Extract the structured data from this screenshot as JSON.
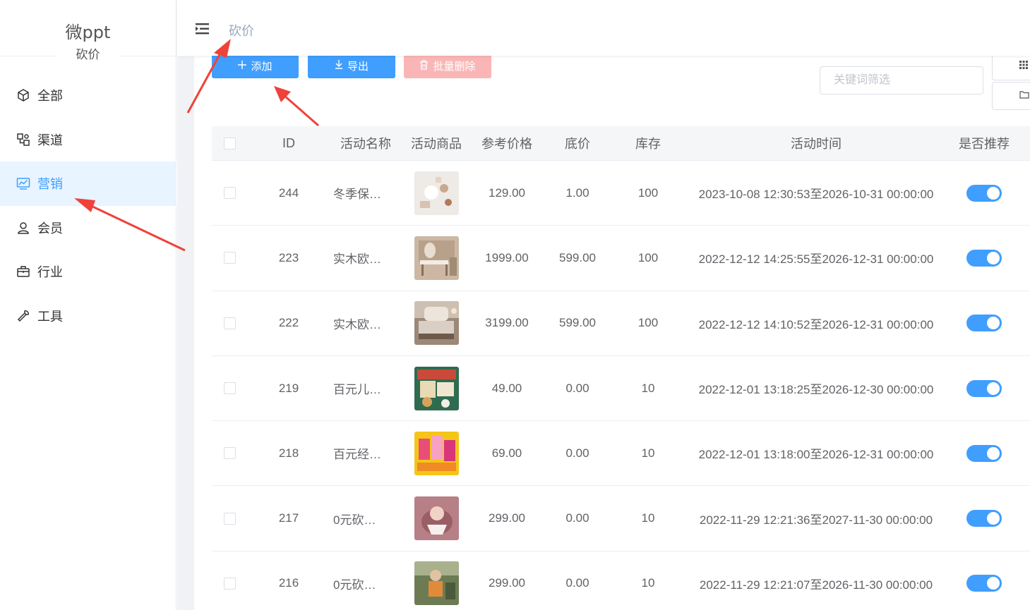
{
  "brand": {
    "title": "微ppt",
    "subtitle": "砍价"
  },
  "nav": {
    "items": [
      {
        "label": "全部",
        "icon": "cube-icon",
        "active": false
      },
      {
        "label": "渠道",
        "icon": "channel-icon",
        "active": false
      },
      {
        "label": "营销",
        "icon": "chart-icon",
        "active": true
      },
      {
        "label": "会员",
        "icon": "user-icon",
        "active": false
      },
      {
        "label": "行业",
        "icon": "briefcase-icon",
        "active": false
      },
      {
        "label": "工具",
        "icon": "wrench-icon",
        "active": false
      }
    ]
  },
  "header": {
    "breadcrumb": "砍价",
    "menu_icon": "hamburger-icon"
  },
  "toolbar": {
    "add_label": "添加",
    "export_label": "导出",
    "batch_delete_label": "批量删除",
    "search_placeholder": "关键词筛选"
  },
  "table": {
    "headers": {
      "id": "ID",
      "name": "活动名称",
      "goods": "活动商品",
      "ref_price": "参考价格",
      "floor_price": "底价",
      "stock": "库存",
      "time": "活动时间",
      "recommend": "是否推荐"
    },
    "rows": [
      {
        "id": "244",
        "name": "冬季保…",
        "ref_price": "129.00",
        "floor_price": "1.00",
        "stock": "100",
        "time": "2023-10-08 12:30:53至2026-10-31 00:00:00",
        "recommend": true
      },
      {
        "id": "223",
        "name": "实木欧…",
        "ref_price": "1999.00",
        "floor_price": "599.00",
        "stock": "100",
        "time": "2022-12-12 14:25:55至2026-12-31 00:00:00",
        "recommend": true
      },
      {
        "id": "222",
        "name": "实木欧…",
        "ref_price": "3199.00",
        "floor_price": "599.00",
        "stock": "100",
        "time": "2022-12-12 14:10:52至2026-12-31 00:00:00",
        "recommend": true
      },
      {
        "id": "219",
        "name": "百元儿…",
        "ref_price": "49.00",
        "floor_price": "0.00",
        "stock": "10",
        "time": "2022-12-01 13:18:25至2026-12-30 00:00:00",
        "recommend": true
      },
      {
        "id": "218",
        "name": "百元经…",
        "ref_price": "69.00",
        "floor_price": "0.00",
        "stock": "10",
        "time": "2022-12-01 13:18:00至2026-12-31 00:00:00",
        "recommend": true
      },
      {
        "id": "217",
        "name": "0元砍…",
        "ref_price": "299.00",
        "floor_price": "0.00",
        "stock": "10",
        "time": "2022-11-29 12:21:36至2027-11-30 00:00:00",
        "recommend": true
      },
      {
        "id": "216",
        "name": "0元砍…",
        "ref_price": "299.00",
        "floor_price": "0.00",
        "stock": "10",
        "time": "2022-11-29 12:21:07至2026-11-30 00:00:00",
        "recommend": true
      }
    ]
  },
  "colors": {
    "primary": "#409eff",
    "danger_light": "#fab6b6",
    "active_bg": "#e8f4ff",
    "arrow": "#f0413a"
  }
}
